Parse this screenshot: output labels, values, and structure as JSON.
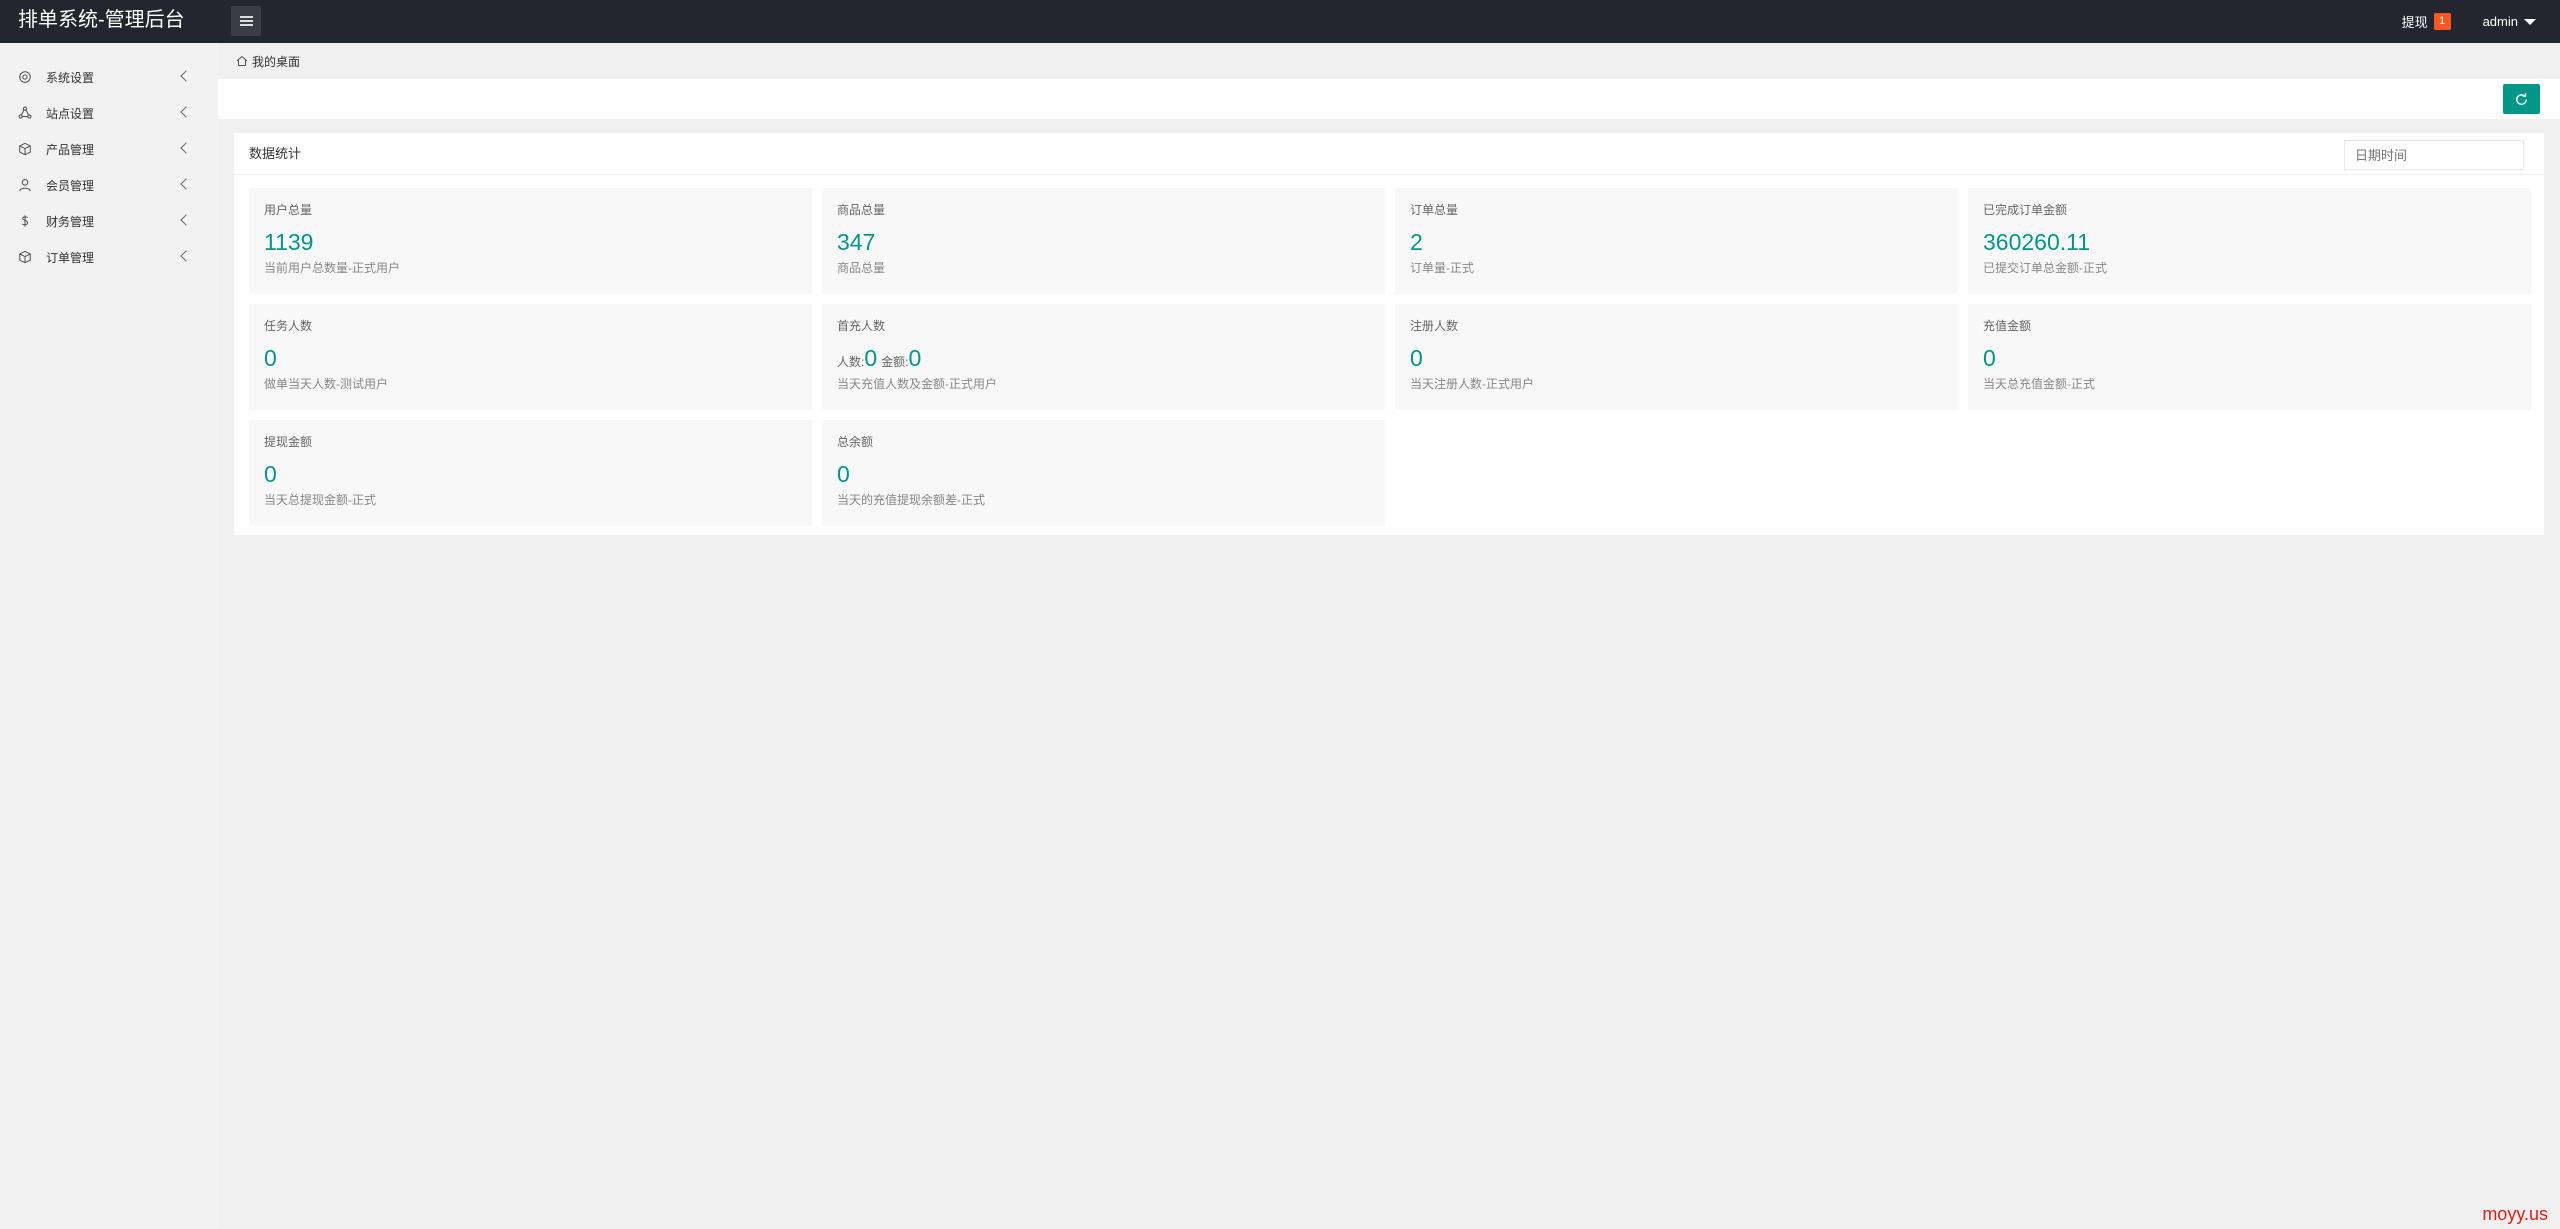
{
  "header": {
    "title": "排单系统-管理后台",
    "withdraw_label": "提现",
    "withdraw_count": "1",
    "user_name": "admin"
  },
  "sidebar": {
    "items": [
      {
        "label": "系统设置",
        "icon": "settings-icon"
      },
      {
        "label": "站点设置",
        "icon": "site-icon"
      },
      {
        "label": "产品管理",
        "icon": "product-icon"
      },
      {
        "label": "会员管理",
        "icon": "user-icon"
      },
      {
        "label": "财务管理",
        "icon": "dollar-icon"
      },
      {
        "label": "订单管理",
        "icon": "order-icon"
      }
    ]
  },
  "breadcrumb": {
    "home_label": "我的桌面"
  },
  "stats_card": {
    "title": "数据统计",
    "date_placeholder": "日期时间",
    "items": [
      {
        "label": "用户总量",
        "value": "1139",
        "desc": "当前用户总数量-正式用户"
      },
      {
        "label": "商品总量",
        "value": "347",
        "desc": "商品总量"
      },
      {
        "label": "订单总量",
        "value": "2",
        "desc": "订单量-正式"
      },
      {
        "label": "已完成订单金额",
        "value": "360260.11",
        "desc": "已提交订单总金额-正式"
      },
      {
        "label": "任务人数",
        "value": "0",
        "desc": "做单当天人数-测试用户"
      },
      {
        "label": "首充人数",
        "count_prefix": "人数:",
        "count_value": "0",
        "amount_prefix": "金额:",
        "amount_value": "0",
        "desc": "当天充值人数及金额-正式用户"
      },
      {
        "label": "注册人数",
        "value": "0",
        "desc": "当天注册人数-正式用户"
      },
      {
        "label": "充值金额",
        "value": "0",
        "desc": "当天总充值金额-正式"
      },
      {
        "label": "提现金额",
        "value": "0",
        "desc": "当天总提现金额-正式"
      },
      {
        "label": "总余额",
        "value": "0",
        "desc": "当天的充值提现余额差-正式"
      }
    ]
  },
  "colors": {
    "accent": "#009688",
    "header_bg": "#23262e",
    "badge": "#ff5722",
    "watermark": "#e0201a"
  },
  "watermark": "moyy.us"
}
